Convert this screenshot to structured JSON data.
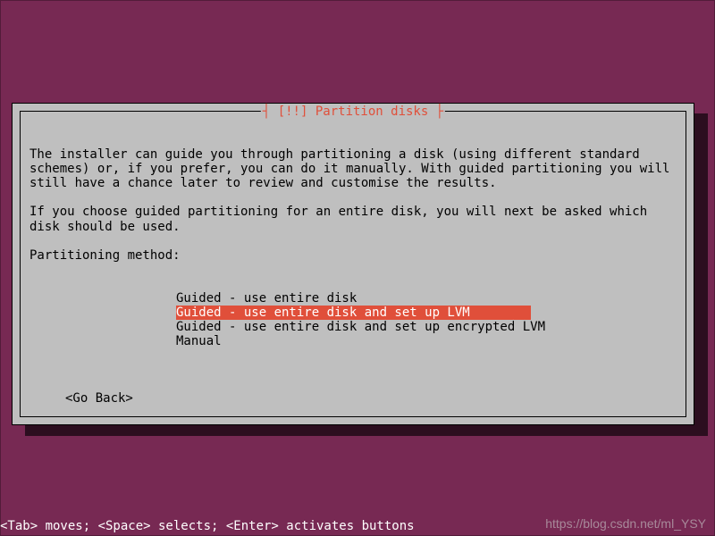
{
  "dialog": {
    "title_decor_left": "┤ ",
    "title_prefix": "[!!] ",
    "title_text": "Partition disks",
    "title_decor_right": " ├",
    "intro_para1": "The installer can guide you through partitioning a disk (using different standard schemes) or, if you prefer, you can do it manually. With guided partitioning you will still have a chance later to review and customise the results.",
    "intro_para2": "If you choose guided partitioning for an entire disk, you will next be asked which disk should be used.",
    "method_label": "Partitioning method:",
    "options": [
      {
        "label": "Guided - use entire disk",
        "selected": false
      },
      {
        "label": "Guided - use entire disk and set up LVM",
        "selected": true
      },
      {
        "label": "Guided - use entire disk and set up encrypted LVM",
        "selected": false
      },
      {
        "label": "Manual",
        "selected": false
      }
    ],
    "go_back": "<Go Back>"
  },
  "help_bar": "<Tab> moves; <Space> selects; <Enter> activates buttons",
  "watermark": "https://blog.csdn.net/ml_YSY"
}
